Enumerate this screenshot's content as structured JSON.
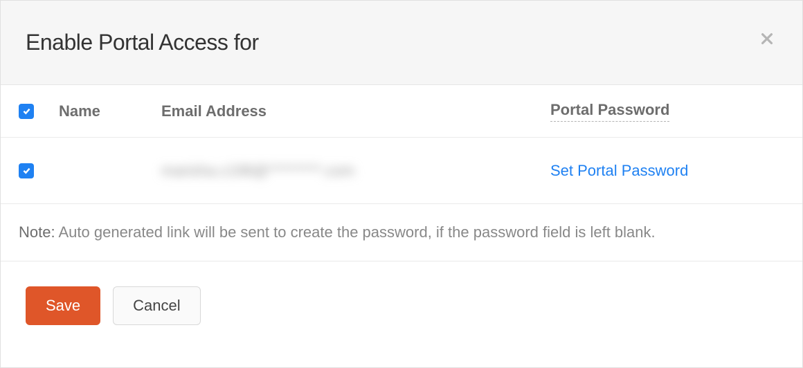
{
  "header": {
    "title": "Enable Portal Access for"
  },
  "table": {
    "columns": {
      "name": "Name",
      "email": "Email Address",
      "portal_password": "Portal Password"
    },
    "rows": [
      {
        "checked": true,
        "name": "",
        "email": "marisha.c198@*********.com",
        "portal_action": "Set Portal Password"
      }
    ]
  },
  "note": {
    "label": "Note:",
    "text": " Auto generated link will be sent to create the password, if the password field is left blank."
  },
  "actions": {
    "save": "Save",
    "cancel": "Cancel"
  }
}
